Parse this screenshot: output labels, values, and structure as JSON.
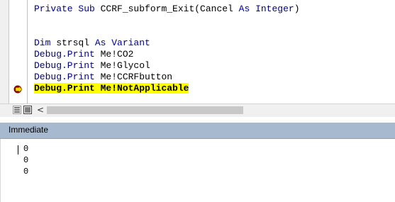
{
  "code": {
    "lines": [
      {
        "prefix": "Private Sub ",
        "rest": "CCRF_subform_Exit(Cancel ",
        "kw2": "As Integer",
        "tail": ")"
      },
      {
        "text": ""
      },
      {
        "text": ""
      },
      {
        "kw": "Dim",
        "rest": " strsql ",
        "kw2": "As Variant"
      },
      {
        "kw": "Debug.Print",
        "rest": " Me!CO2"
      },
      {
        "kw": "Debug.Print",
        "rest": " Me!Glycol"
      },
      {
        "kw": "Debug.Print",
        "rest": " Me!CCRFbutton"
      },
      {
        "kw": "Debug.Print",
        "rest": " Me!NotApplicable"
      }
    ],
    "current_line_index": 7
  },
  "icons": {
    "breakpoint": "execution-arrow-icon",
    "procedure_view": "procedure-view-icon",
    "full_module_view": "full-module-view-icon",
    "scroll_left": "<"
  },
  "immediate": {
    "title": "Immediate",
    "output": [
      "0",
      "0",
      "0"
    ]
  },
  "colors": {
    "keyword": "#00008b",
    "current_line_highlight": "#ffff00",
    "pane_title": "#a7b9cf"
  }
}
